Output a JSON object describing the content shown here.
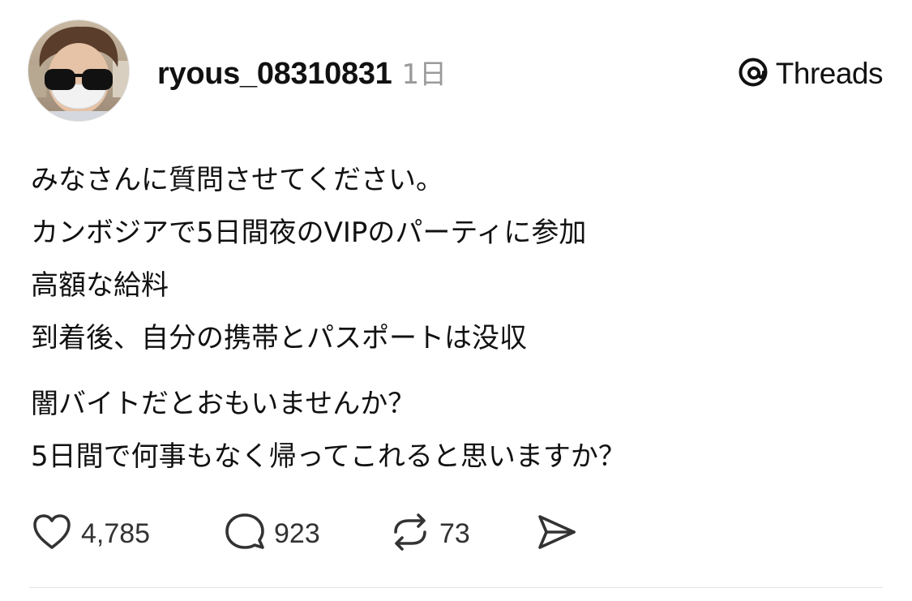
{
  "author": {
    "username": "ryous_08310831",
    "timestamp": "1日"
  },
  "brand": {
    "label": "Threads",
    "icon": "threads-logo-icon"
  },
  "post": {
    "paragraphs": [
      [
        "みなさんに質問させてください。",
        "カンボジアで5日間夜のVIPのパーティに参加",
        "高額な給料",
        "到着後、自分の携帯とパスポートは没収"
      ],
      [
        "闇バイトだとおもいませんか？",
        "5日間で何事もなく帰ってこれると思いますか？"
      ]
    ]
  },
  "actions": {
    "likes": {
      "icon": "heart-icon",
      "count": "4,785"
    },
    "replies": {
      "icon": "comment-bubble-icon",
      "count": "923"
    },
    "reposts": {
      "icon": "repost-icon",
      "count": "73"
    },
    "share": {
      "icon": "send-icon"
    }
  },
  "colors": {
    "text": "#111111",
    "muted": "#9a9a9a",
    "divider": "#e2e2e2",
    "background": "#ffffff"
  }
}
